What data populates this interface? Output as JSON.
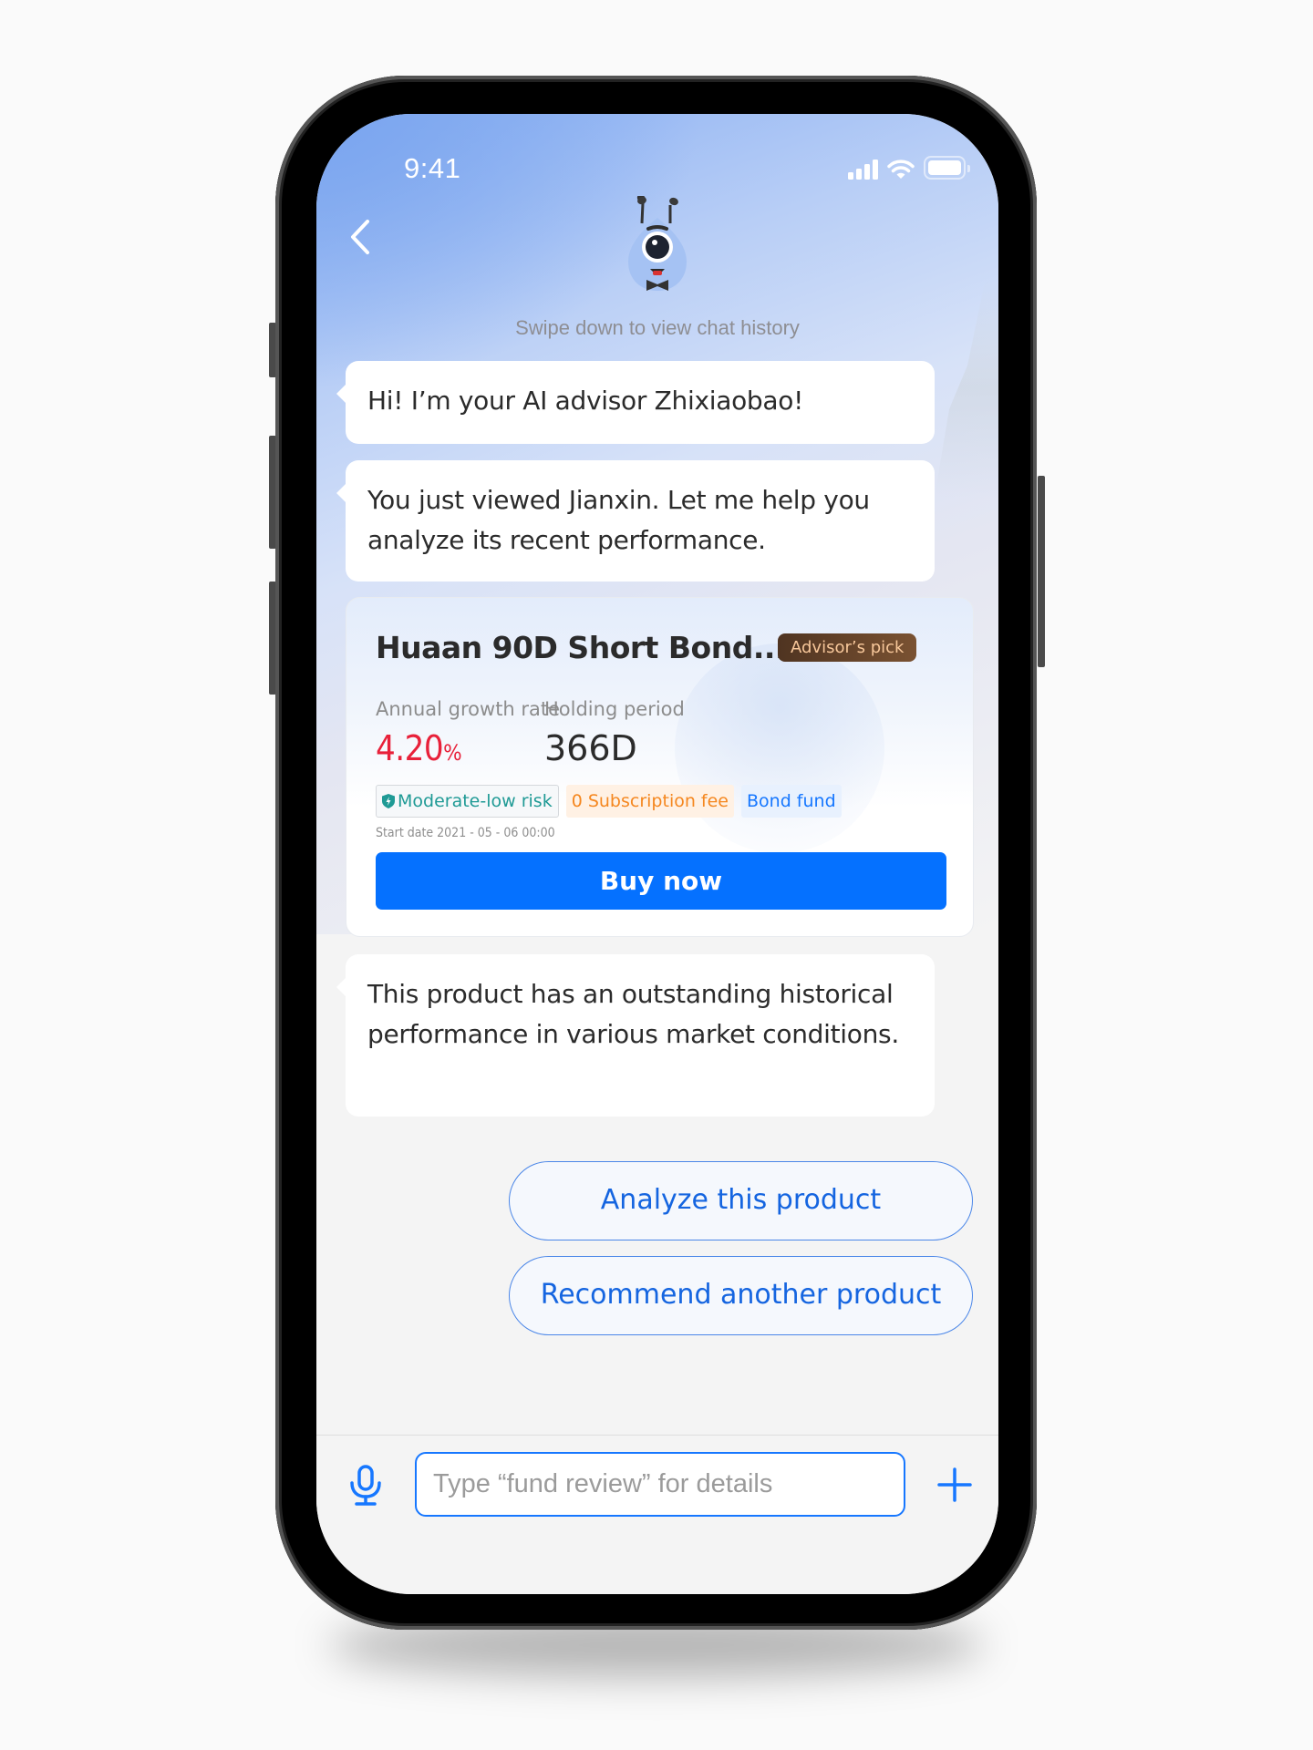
{
  "status_bar": {
    "time": "9:41",
    "icons": [
      "cellular-signal-icon",
      "wifi-icon",
      "battery-icon"
    ]
  },
  "header": {
    "back_icon": "chevron-left-icon",
    "avatar": "ai-advisor-mascot",
    "history_hint": "Swipe down to view chat history"
  },
  "messages": [
    {
      "sender": "advisor",
      "text": "Hi! I’m your AI advisor Zhixiaobao!"
    },
    {
      "sender": "advisor",
      "text": "You just viewed Jianxin. Let me help you analyze its recent performance."
    },
    {
      "sender": "advisor",
      "text": "This product has an outstanding historical performance in various market conditions."
    }
  ],
  "product_card": {
    "title": "Huaan 90D Short Bond...",
    "badge": "Advisor’s pick",
    "metrics": {
      "growth_label": "Annual growth rate",
      "growth_value": "4.20",
      "growth_unit": "%",
      "period_label": "Holding period",
      "period_value": "366D"
    },
    "tags": [
      {
        "label": "Moderate-low risk",
        "icon": "shield-icon",
        "color": "#1f9a95"
      },
      {
        "label": "0 Subscription fee",
        "color": "#f5871f"
      },
      {
        "label": "Bond fund",
        "color": "#1677ff"
      }
    ],
    "start_date": "Start date 2021 - 05 - 06 00:00",
    "buy_label": "Buy now"
  },
  "quick_replies": [
    "Analyze this product",
    "Recommend another product"
  ],
  "composer": {
    "mic_icon": "microphone-icon",
    "placeholder": "Type “fund review” for details",
    "value": "",
    "plus_icon": "plus-icon"
  },
  "colors": {
    "accent": "#1677ff",
    "buy_button": "#0571ff",
    "growth_red": "#e8213a",
    "badge_bg": "#5e3f27",
    "badge_text": "#f7c79a"
  }
}
